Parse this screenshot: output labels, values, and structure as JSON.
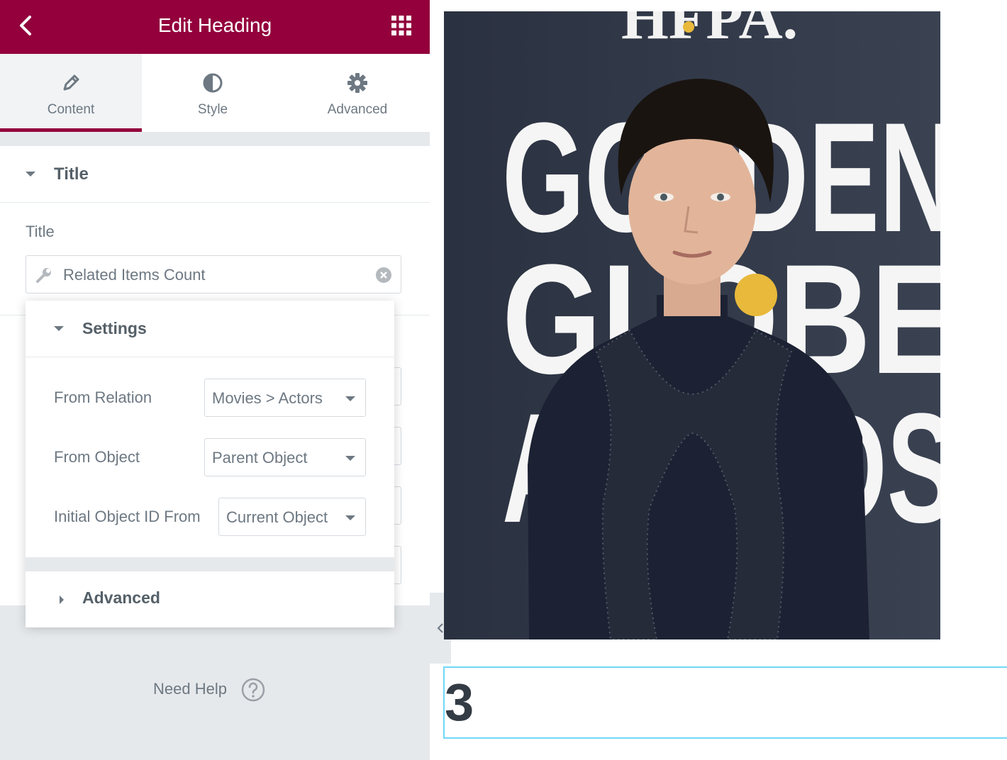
{
  "header": {
    "title": "Edit Heading",
    "back_icon": "chevron-left-icon",
    "menu_icon": "grid-icon",
    "color": "#93003c"
  },
  "tabs": [
    {
      "label": "Content",
      "icon": "pencil-icon",
      "active": true
    },
    {
      "label": "Style",
      "icon": "half-circle-icon",
      "active": false
    },
    {
      "label": "Advanced",
      "icon": "gear-icon",
      "active": false
    }
  ],
  "section": {
    "title": "Title",
    "field_label": "Title",
    "input_value": "Related Items Count"
  },
  "popover": {
    "settings_title": "Settings",
    "rows": [
      {
        "label": "From Relation",
        "value": "Movies > Actors"
      },
      {
        "label": "From Object",
        "value": "Parent Object"
      },
      {
        "label": "Initial Object ID From",
        "value": "Current Object"
      }
    ],
    "advanced_title": "Advanced"
  },
  "help": {
    "label": "Need Help"
  },
  "preview": {
    "heading_value": "3",
    "backdrop_text": [
      "HFPA.",
      "GOLDEN",
      "GLOBE",
      "AWARDS"
    ]
  }
}
